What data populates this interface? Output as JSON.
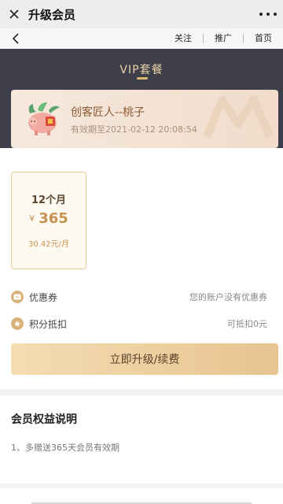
{
  "window": {
    "title": "升级会员"
  },
  "nav": {
    "follow": "关注",
    "promote": "推广",
    "home": "首页"
  },
  "hero": {
    "title": "VIP套餐"
  },
  "profile": {
    "name": "创客匠人--桃子",
    "expire": "有效期至2021-02-12 20:08:54"
  },
  "plan": {
    "duration": "12个月",
    "currency": "¥",
    "price": "365",
    "monthly": "30.42元/月"
  },
  "coupon": {
    "label": "优惠券",
    "value": "您的账户没有优惠券"
  },
  "points": {
    "label": "积分抵扣",
    "value": "可抵扣0元"
  },
  "action": {
    "label": "立即升级/续费"
  },
  "benefits": {
    "title": "会员权益说明",
    "item1": "1、多赠送365天会员有效期"
  },
  "colors": {
    "hero_bg": "#3f3f4b",
    "gold": "#e0b770",
    "accent_text": "#c8914e"
  },
  "icons": [
    "close-icon",
    "more-icon",
    "back-icon",
    "coupon-icon",
    "points-icon"
  ]
}
